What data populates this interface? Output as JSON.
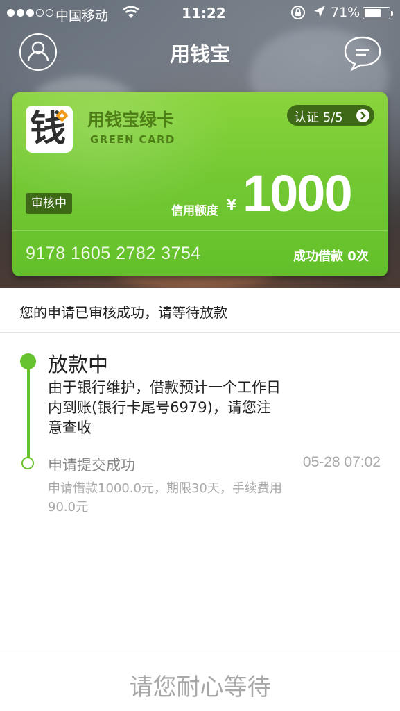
{
  "status_bar": {
    "carrier": "中国移动",
    "time": "11:22",
    "battery_percent": "71%",
    "battery_level": 0.71,
    "signal_bars_filled": 3,
    "signal_bars_total": 5
  },
  "nav": {
    "title": "用钱宝",
    "left_icon": "profile-icon",
    "right_icon": "message-icon"
  },
  "card": {
    "logo_char": "钱",
    "title": "用钱宝绿卡",
    "subtitle": "GREEN CARD",
    "verify_label": "认证 5/5",
    "status_badge": "审核中",
    "credit_label": "信用额度",
    "currency": "¥",
    "credit_amount": "1000",
    "card_number": "9178  1605  2782  3754",
    "success_label": "成功借款 0次",
    "colors": {
      "card": "#74c933",
      "badge": "#3e6a17",
      "logo_accent": "#f39a1a"
    }
  },
  "notice": "您的申请已审核成功，请等待放款",
  "timeline": {
    "accent_color": "#66c22d",
    "steps": [
      {
        "title": "放款中",
        "description": "由于银行维护，借款预计一个工作日内到账(银行卡尾号6979)，请您注意查收",
        "time": ""
      },
      {
        "title": "申请提交成功",
        "description": "申请借款1000.0元，期限30天，手续费用90.0元",
        "time": "05-28 07:02"
      }
    ]
  },
  "footer": {
    "button_label": "请您耐心等待"
  }
}
